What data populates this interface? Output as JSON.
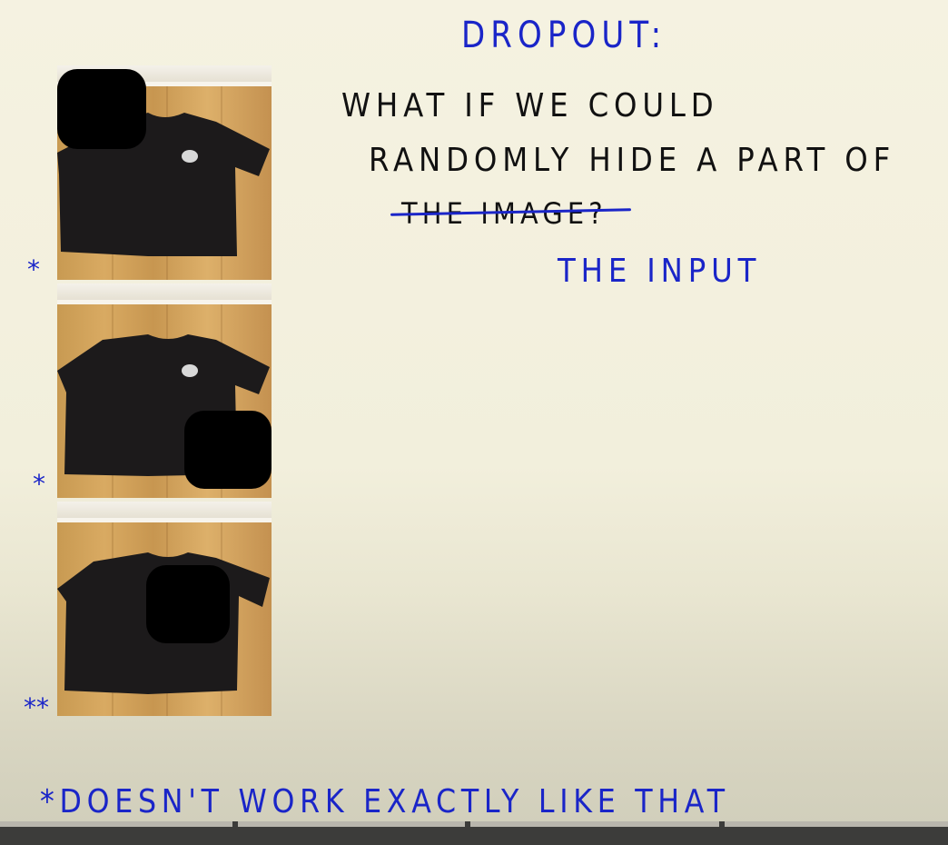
{
  "title": "DROPOUT:",
  "question_lines": [
    "WHAT IF WE COULD",
    "RANDOMLY HIDE A PART OF",
    "THE IMAGE?"
  ],
  "replacement": "THE INPUT",
  "stars": [
    "*",
    "*",
    "**"
  ],
  "footnote": "*DOESN'T WORK EXACTLY LIKE THAT",
  "images": [
    {
      "alt": "t-shirt with top-left masked"
    },
    {
      "alt": "t-shirt with bottom-right masked"
    },
    {
      "alt": "t-shirt with center masked"
    }
  ],
  "colors": {
    "ink_blue": "#1a25c8",
    "ink_black": "#111111",
    "paper": "#f5f2e1"
  }
}
